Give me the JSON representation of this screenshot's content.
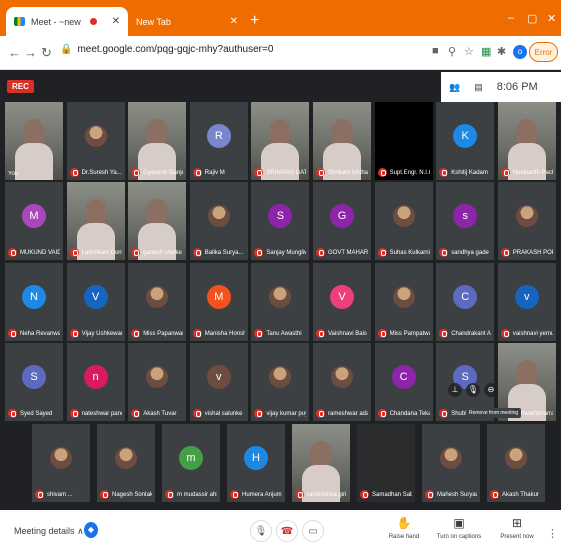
{
  "browser": {
    "tabs": [
      {
        "title": "Meet - ~new",
        "active": true
      },
      {
        "title": "New Tab",
        "active": false
      }
    ],
    "url": "meet.google.com/pqg-gqjc-mhy?authuser=0",
    "profile_initial": "o",
    "error_label": "Error"
  },
  "meeting": {
    "rec_label": "REC",
    "time": "8:06 PM",
    "tooltip": "Remove from meeting"
  },
  "participants": [
    {
      "name": "You",
      "type": "video",
      "color": "#5a5f5c"
    },
    {
      "name": "Dr.Suresh Ya...",
      "type": "photo",
      "color": "#3c4043"
    },
    {
      "name": "Gyanesh Ganjer",
      "type": "video",
      "color": "#5a5f5c"
    },
    {
      "name": "Rajiv M",
      "type": "letter",
      "initial": "R",
      "color": "#7986cb"
    },
    {
      "name": "SRINIVAS GATLE...",
      "type": "video",
      "color": "#5a5f5c"
    },
    {
      "name": "Shrikant Ishthar",
      "type": "video",
      "color": "#5a5f5c"
    },
    {
      "name": "Supt.Engr. N.I.C. ...",
      "type": "dark",
      "color": "#000000"
    },
    {
      "name": "Kshitij Kadam",
      "type": "letter",
      "initial": "K",
      "color": "#1e88e5"
    },
    {
      "name": "Neelkanth Pacha...",
      "type": "video",
      "color": "#5a5f5c"
    },
    {
      "name": "MUKUND VAIDYA",
      "type": "letter",
      "initial": "M",
      "color": "#ab47bc"
    },
    {
      "name": "Laxmikant Donto...",
      "type": "video",
      "color": "#5a5f5c"
    },
    {
      "name": "ganesh shelke",
      "type": "video",
      "color": "#5a5f5c"
    },
    {
      "name": "Balika Surya...",
      "type": "photo",
      "color": "#3c4043"
    },
    {
      "name": "Sanjay Mungliwar",
      "type": "letter",
      "initial": "S",
      "color": "#8e24aa"
    },
    {
      "name": "GOVT MAHARAS...",
      "type": "letter",
      "initial": "G",
      "color": "#8e24aa"
    },
    {
      "name": "Suhas Kulkarni",
      "type": "photo",
      "color": "#3c4043"
    },
    {
      "name": "sandhya gade",
      "type": "letter",
      "initial": "s",
      "color": "#8e24aa"
    },
    {
      "name": "PRAKASH POPLE",
      "type": "photo",
      "color": "#3c4043"
    },
    {
      "name": "Neha Revanwar",
      "type": "letter",
      "initial": "N",
      "color": "#1e88e5"
    },
    {
      "name": "Vijay Ushkewar",
      "type": "letter",
      "initial": "V",
      "color": "#1565c0"
    },
    {
      "name": "Miss Papanwar S...",
      "type": "photo",
      "color": "#3c4043"
    },
    {
      "name": "Manisha Honshet...",
      "type": "letter",
      "initial": "M",
      "color": "#f4511e"
    },
    {
      "name": "Tanu Awasthi",
      "type": "photo",
      "color": "#3c4043"
    },
    {
      "name": "Vaishnavi Bais",
      "type": "letter",
      "initial": "V",
      "color": "#ec407a"
    },
    {
      "name": "Miss Pampatwar ...",
      "type": "photo",
      "color": "#3c4043"
    },
    {
      "name": "Chandrakant Ash...",
      "type": "letter",
      "initial": "C",
      "color": "#5c6bc0"
    },
    {
      "name": "vaishnavi yemul",
      "type": "letter",
      "initial": "v",
      "color": "#1565c0"
    },
    {
      "name": "Syed Sayed",
      "type": "letter",
      "initial": "S",
      "color": "#5c6bc0"
    },
    {
      "name": "nateshwar panchal",
      "type": "letter",
      "initial": "n",
      "color": "#d81b60"
    },
    {
      "name": "Akash Tuvar",
      "type": "photo",
      "color": "#3c4043"
    },
    {
      "name": "vishal salunke",
      "type": "letter",
      "initial": "v",
      "color": "#6d4c41"
    },
    {
      "name": "vijay kumar puyed",
      "type": "photo",
      "color": "#3c4043"
    },
    {
      "name": "rameshwar adam...",
      "type": "photo",
      "color": "#3c4043"
    },
    {
      "name": "Chandana Tekale",
      "type": "letter",
      "initial": "C",
      "color": "#8e24aa"
    },
    {
      "name": "Shubham ...",
      "type": "letter",
      "initial": "S",
      "color": "#5c6bc0"
    },
    {
      "name": "Vishwambharrao ...",
      "type": "video",
      "color": "#5a5f5c"
    },
    {
      "name": "shivam ...",
      "type": "photo",
      "color": "#3c4043"
    },
    {
      "name": "Nagesh Sontakke",
      "type": "photo",
      "color": "#3c4043"
    },
    {
      "name": "m mudassir ahm...",
      "type": "letter",
      "initial": "m",
      "color": "#43a047"
    },
    {
      "name": "Humera Anjum",
      "type": "letter",
      "initial": "H",
      "color": "#1e88e5"
    },
    {
      "name": "ramkrishna giri",
      "type": "video",
      "color": "#5a5f5c"
    },
    {
      "name": "Samadhan Sabbi...",
      "type": "dark",
      "color": "#2b2c2e"
    },
    {
      "name": "Mahesh Suryawa...",
      "type": "photo",
      "color": "#3c4043"
    },
    {
      "name": "Akash Thakur",
      "type": "photo",
      "color": "#3c4043"
    }
  ],
  "bottom": {
    "meeting_details": "Meeting details",
    "raise_hand": "Raise hand",
    "captions": "Turn on captions",
    "present": "Present now"
  }
}
